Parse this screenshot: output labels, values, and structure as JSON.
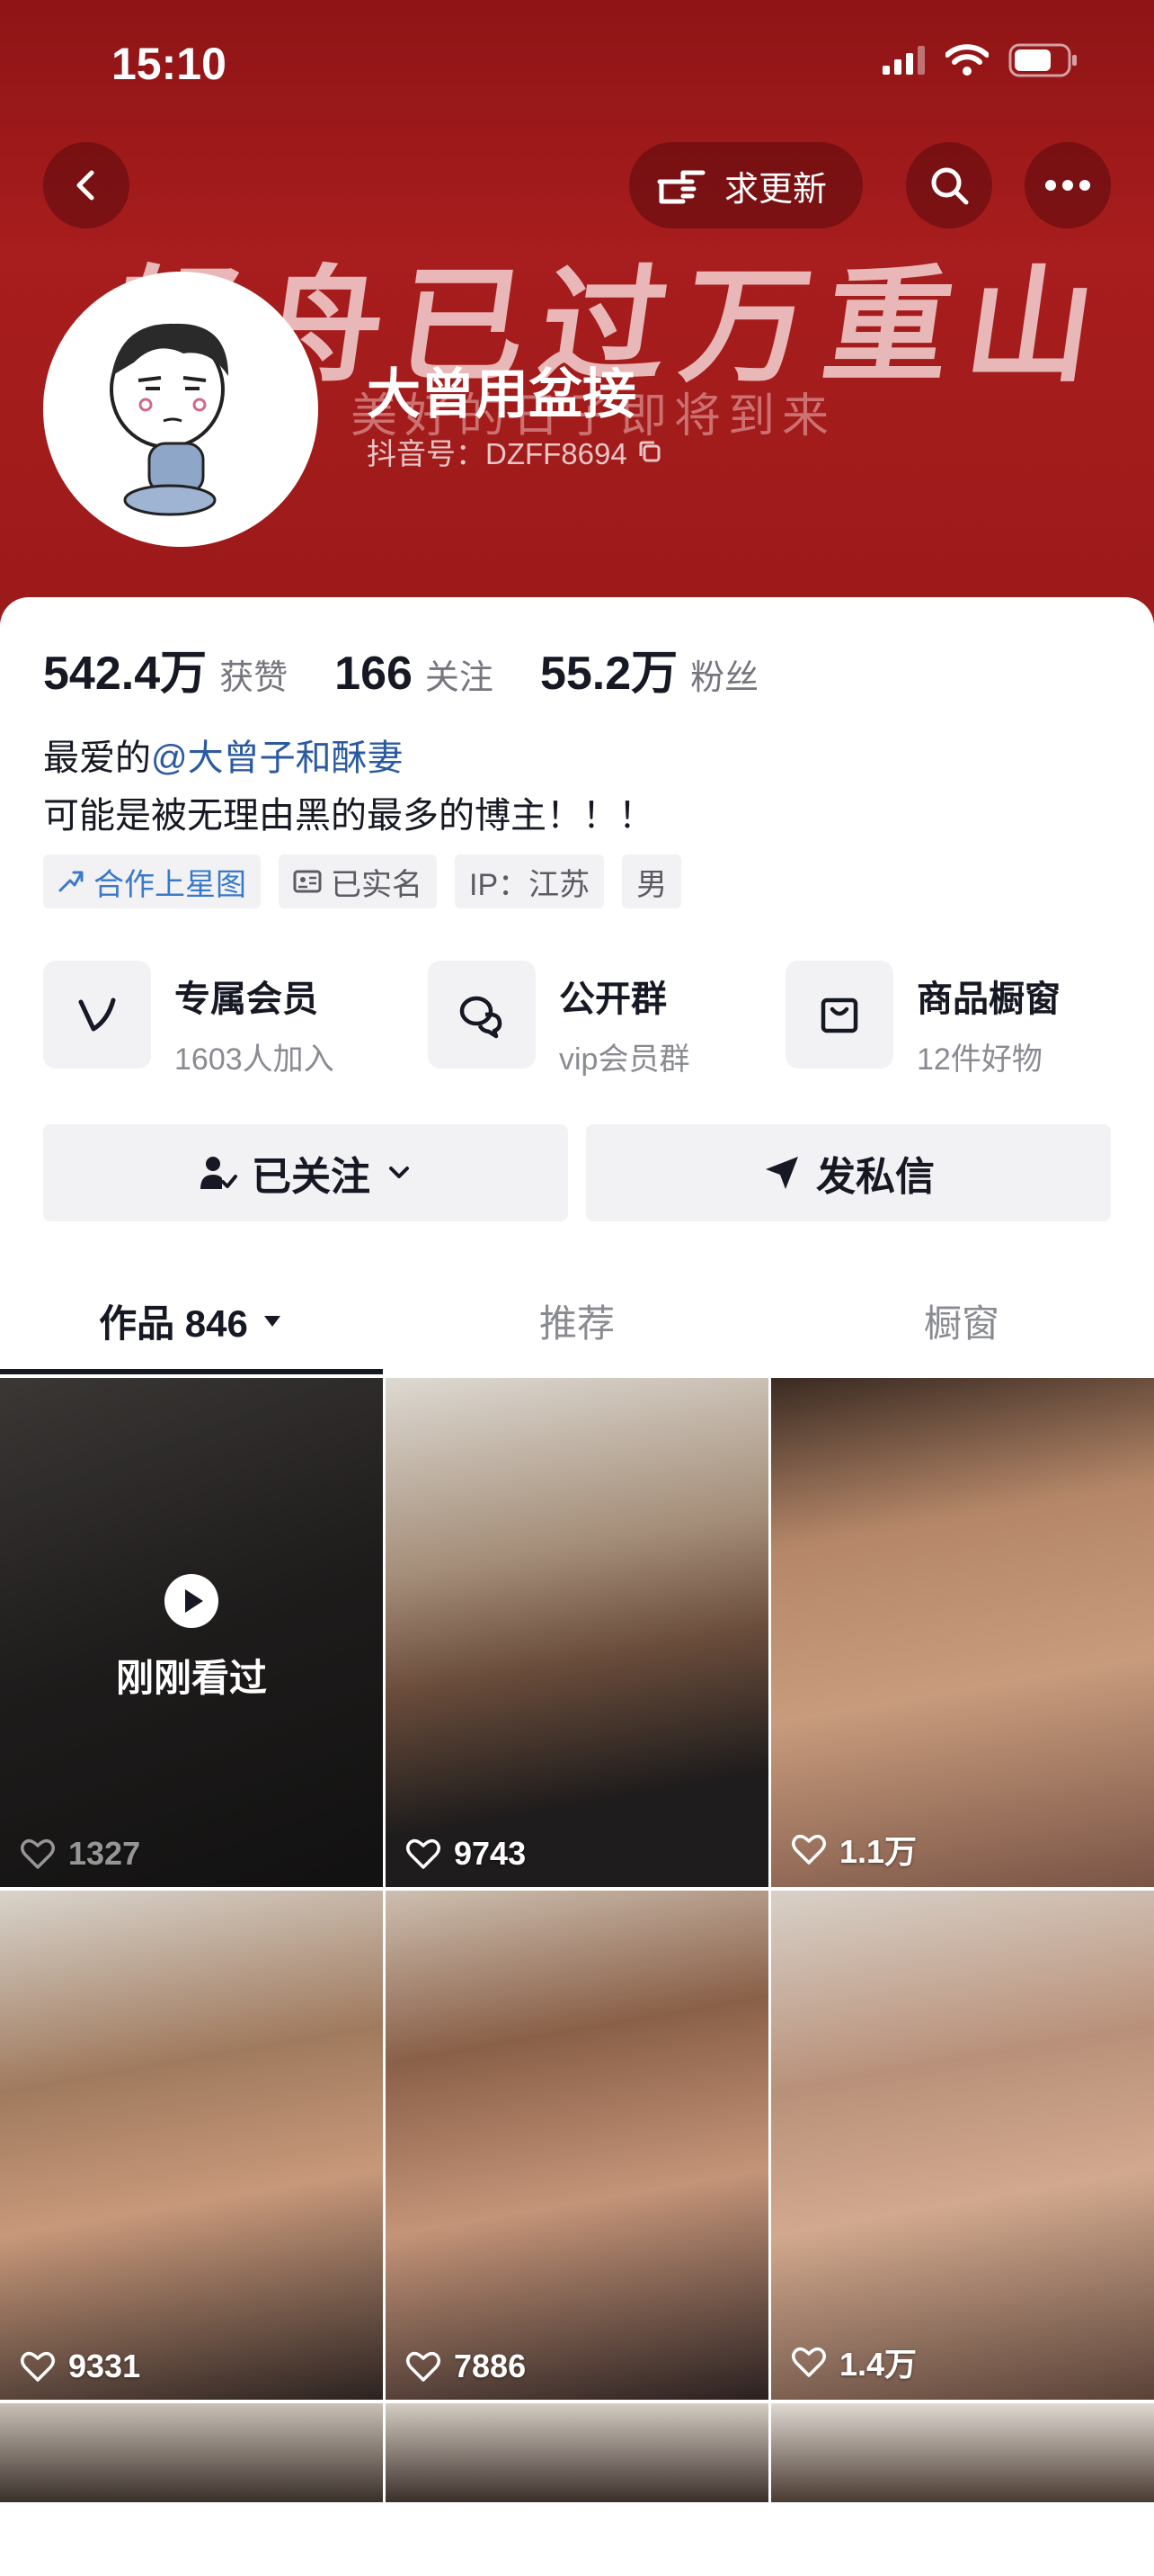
{
  "status_bar": {
    "time": "15:10"
  },
  "header": {
    "request_update_label": "求更新",
    "banner_text": "轻舟已过万重山",
    "banner_subtext": "美好的日子即将到来"
  },
  "profile": {
    "nickname": "大曾用盆接",
    "douyin_id": "抖音号：DZFF8694",
    "stats": [
      {
        "value": "542.4万",
        "label": "获赞"
      },
      {
        "value": "166",
        "label": "关注"
      },
      {
        "value": "55.2万",
        "label": "粉丝"
      }
    ],
    "bio_prefix": "最爱的",
    "bio_mention": "@大曾子和酥妻",
    "bio_line2": "可能是被无理由黑的最多的博主！！！",
    "tags": [
      "合作上星图",
      "已实名",
      "IP：江苏",
      "男"
    ]
  },
  "features": [
    {
      "title": "专属会员",
      "subtitle": "1603人加入",
      "icon": "v-member-icon"
    },
    {
      "title": "公开群",
      "subtitle": "vip会员群",
      "icon": "chat-group-icon"
    },
    {
      "title": "商品橱窗",
      "subtitle": "12件好物",
      "icon": "shopping-bag-icon"
    }
  ],
  "actions": {
    "followed_label": "已关注",
    "message_label": "发私信"
  },
  "tabs": [
    {
      "label": "作品 846"
    },
    {
      "label": "推荐"
    },
    {
      "label": "橱窗"
    }
  ],
  "videos": [
    {
      "likes": "1327",
      "overlay": "刚刚看过"
    },
    {
      "likes": "9743"
    },
    {
      "likes": "1.1万"
    },
    {
      "likes": "9331"
    },
    {
      "likes": "7886"
    },
    {
      "likes": "1.4万"
    }
  ],
  "colors": {
    "banner": "#9c1a1a",
    "mention": "#2b5aa0",
    "tag_blue": "#3a79c9"
  }
}
